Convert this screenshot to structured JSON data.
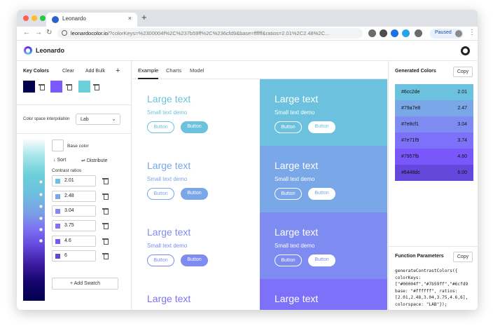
{
  "browser": {
    "tab_title": "Leonardo",
    "tab_close": "×",
    "new_tab": "+",
    "url_domain": "leonardocolor.io",
    "url_rest": "/?colorKeys=%2300004f%2C%237b59ff%2C%236cfd9&base=ffffff&ratios=2.01%2C2.48%2C...",
    "paused_label": "Paused",
    "back": "←",
    "forward": "→",
    "reload": "↻",
    "kebab": "⋮"
  },
  "app": {
    "title": "Leonardo"
  },
  "left": {
    "key_colors_label": "Key Colors",
    "clear_label": "Clear",
    "add_bulk_label": "Add Bulk",
    "add_icon": "+",
    "key_colors": [
      "#00004f",
      "#7b59ff",
      "#6cd0d9"
    ],
    "interp_label": "Color space interpolation",
    "interp_value": "Lab",
    "base_color_label": "Base color",
    "sort_label": "Sort",
    "distribute_label": "Distribute",
    "contrast_label": "Contrast ratios",
    "ratios": [
      {
        "value": "2.01",
        "color": "#6cc2de"
      },
      {
        "value": "2.48",
        "color": "#79a7e8"
      },
      {
        "value": "3.04",
        "color": "#7e8cf1"
      },
      {
        "value": "3.75",
        "color": "#7e71f9"
      },
      {
        "value": "4.6",
        "color": "#7957fb"
      },
      {
        "value": "6",
        "color": "#6448dc"
      }
    ],
    "add_swatch_label": "Add Swatch"
  },
  "center": {
    "tabs": [
      "Example",
      "Charts",
      "Model"
    ],
    "large_text": "Large text",
    "small_text": "Small text demo",
    "button_label": "Button",
    "cells": [
      {
        "bg": "#ffffff",
        "fg": "#6cc2de"
      },
      {
        "bg": "#6cc2de",
        "fg": "#ffffff"
      },
      {
        "bg": "#ffffff",
        "fg": "#79a7e8"
      },
      {
        "bg": "#79a7e8",
        "fg": "#ffffff"
      },
      {
        "bg": "#ffffff",
        "fg": "#7e8cf1"
      },
      {
        "bg": "#7e8cf1",
        "fg": "#ffffff"
      },
      {
        "bg": "#ffffff",
        "fg": "#7e71f9"
      },
      {
        "bg": "#7e71f9",
        "fg": "#ffffff"
      }
    ]
  },
  "right": {
    "generated_label": "Generated Colors",
    "copy_label": "Copy",
    "generated": [
      {
        "hex": "#6cc2de",
        "ratio": "2.01"
      },
      {
        "hex": "#79a7e8",
        "ratio": "2.47"
      },
      {
        "hex": "#7e8cf1",
        "ratio": "3.04"
      },
      {
        "hex": "#7e71f9",
        "ratio": "3.74"
      },
      {
        "hex": "#7957fb",
        "ratio": "4.60"
      },
      {
        "hex": "#6448dc",
        "ratio": "6.00"
      }
    ],
    "function_label": "Function Parameters",
    "code": "generateContrastColors({\ncolorKeys:\n[\"#00004f\",\"#7b59ff\",\"#6cfd9\nbase: \"#ffffff\", ratios:\n[2.01,2.48,3.04,3.75,4.6,6],\ncolorspace: \"LAB\"});"
  }
}
